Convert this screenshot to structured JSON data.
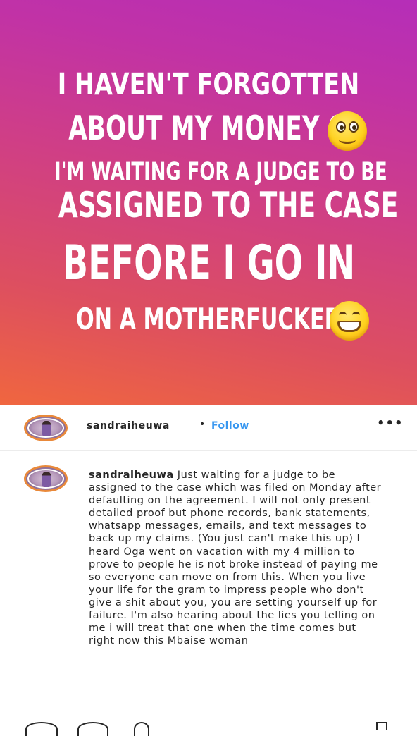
{
  "story": {
    "lines": [
      "I HAVEN'T FORGOTTEN",
      "ABOUT MY MONEY O",
      "I'M WAITING FOR A JUDGE TO BE",
      "ASSIGNED TO THE CASE",
      "BEFORE I GO IN",
      "ON A MOTHERFUCKER"
    ],
    "emoji_1": "rolling-eyes-emoji",
    "emoji_2": "grinning-emoji",
    "gradient_colors": [
      "#f0663f",
      "#cf3e87",
      "#b52eb8"
    ]
  },
  "post": {
    "username": "sandraiheuwa",
    "separator": "•",
    "follow_label": "Follow",
    "more_label": "•••",
    "caption_user": "sandraiheuwa",
    "caption_text": "Just waiting for a judge to be assigned to the case which was filed on Monday after defaulting on the agreement. I will not only present detailed proof but phone records, bank statements, whatsapp messages, emails, and text messages to back up my claims. (You just can't make this up) I heard Oga went on vacation with my 4 million to prove to people he is not broke instead of paying me so everyone can move on from this. When you live your life for the gram to impress people who don't give a shit about you, you are setting yourself up for failure. I'm also hearing about the lies you telling on me i will treat that one when the time comes but right now this Mbaise woman",
    "accent_color": "#3897f0"
  },
  "actions": {
    "icons": [
      "heart-icon",
      "comment-icon",
      "share-icon",
      "bookmark-icon"
    ]
  }
}
